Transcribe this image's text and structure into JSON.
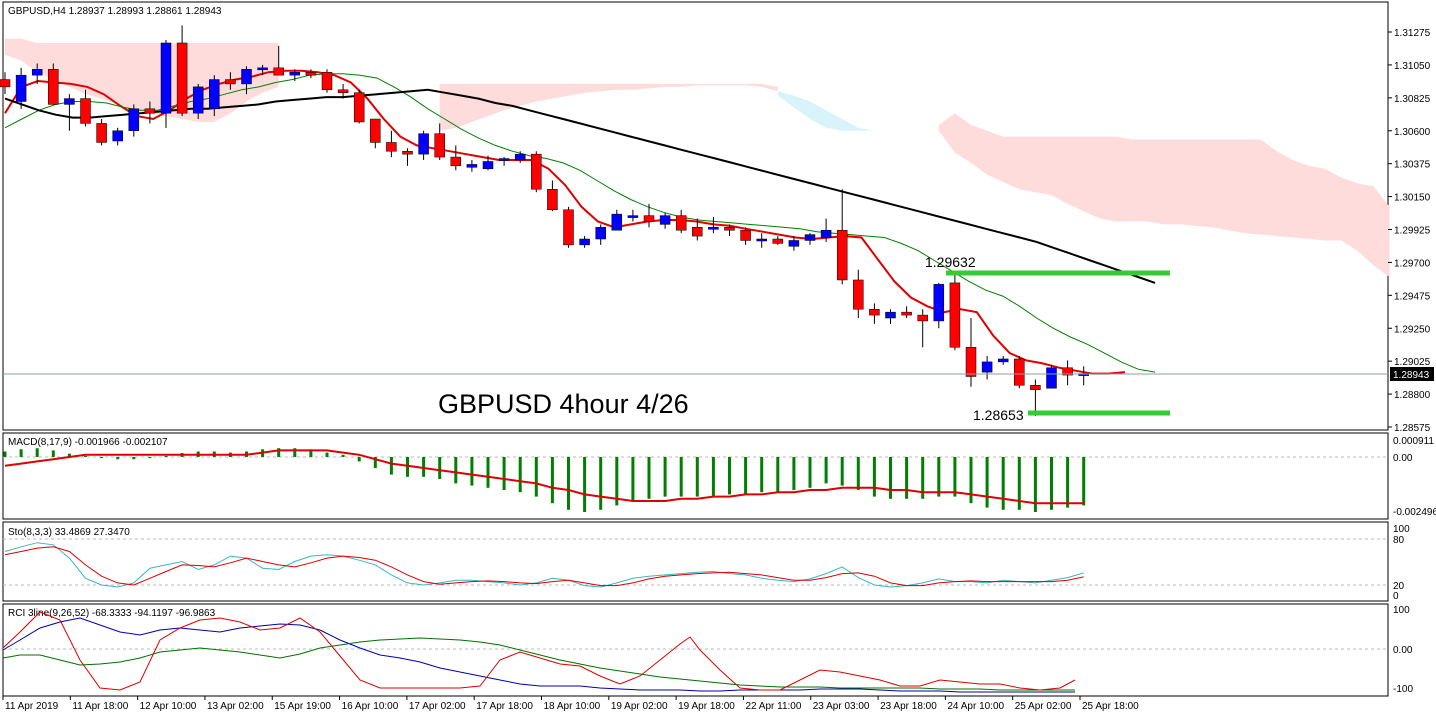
{
  "header": {
    "symbol_line": "GBPUSD,H4  1.28937 1.28993 1.28861 1.28943",
    "annotation": "GBPUSD 4hour 4/26"
  },
  "price_axis": {
    "ticks": [
      "1.31275",
      "1.31050",
      "1.30825",
      "1.30600",
      "1.30375",
      "1.30150",
      "1.29925",
      "1.29700",
      "1.29475",
      "1.29250",
      "1.29025",
      "1.28800",
      "1.28575"
    ],
    "tick_values": [
      1.31275,
      1.3105,
      1.30825,
      1.306,
      1.30375,
      1.3015,
      1.29925,
      1.297,
      1.29475,
      1.2925,
      1.29025,
      1.288,
      1.28575
    ],
    "current_price_label": "1.28943",
    "current_price": 1.28943
  },
  "time_axis": {
    "labels": [
      "11 Apr 2019",
      "11 Apr 18:00",
      "12 Apr 10:00",
      "13 Apr 02:00",
      "15 Apr 19:00",
      "16 Apr 10:00",
      "17 Apr 02:00",
      "17 Apr 18:00",
      "18 Apr 10:00",
      "19 Apr 02:00",
      "19 Apr 18:00",
      "22 Apr 11:00",
      "23 Apr 03:00",
      "23 Apr 18:00",
      "24 Apr 10:00",
      "25 Apr 02:00",
      "25 Apr 18:00"
    ]
  },
  "levels": {
    "high_label": "1.29632",
    "high_value": 1.29632,
    "low_label": "1.28653",
    "low_value": 1.28653
  },
  "macd": {
    "title": "MACD(8,17,9) -0.001966 -0.002107",
    "ticks": [
      "0.000911",
      "0.00",
      "-0.002496"
    ]
  },
  "stochastic": {
    "title": "Sto(8,3,3) 33.4869 27.3470",
    "ticks": [
      "100",
      "80",
      "20",
      "0"
    ]
  },
  "rci": {
    "title": "RCI 3line(9,26,52) -68.3333 -94.1197 -96.9863",
    "ticks": [
      "100",
      "0.00",
      "-100"
    ]
  },
  "colors": {
    "bull": "#0000ff",
    "bear": "#ff0000",
    "kumo_bear": "#ffdcdc",
    "kumo_bull": "#d8f4fa",
    "ma_fast": "#e00000",
    "ma_mid": "#008000",
    "ma_slow": "#000000",
    "level_line": "#33cc33",
    "macd_hist": "#008000",
    "macd_signal": "#dd0000",
    "sto_main": "#3cb4c8",
    "sto_signal": "#dd0000",
    "rci_short": "#dd0000",
    "rci_mid": "#007000",
    "rci_long": "#0000aa"
  },
  "chart_data": {
    "type": "candlestick",
    "title": "GBPUSD,H4",
    "ylim": [
      1.28575,
      1.31275
    ],
    "candles": [
      [
        1.3095,
        1.31,
        1.3085,
        1.309
      ],
      [
        1.308,
        1.3103,
        1.3075,
        1.3098
      ],
      [
        1.3098,
        1.3106,
        1.3092,
        1.3102
      ],
      [
        1.3102,
        1.3106,
        1.3078,
        1.3078
      ],
      [
        1.3078,
        1.3085,
        1.306,
        1.3082
      ],
      [
        1.3082,
        1.3088,
        1.3063,
        1.3065
      ],
      [
        1.3065,
        1.3068,
        1.305,
        1.3052
      ],
      [
        1.3053,
        1.3062,
        1.305,
        1.306
      ],
      [
        1.306,
        1.3078,
        1.3056,
        1.3075
      ],
      [
        1.3075,
        1.308,
        1.3065,
        1.3072
      ],
      [
        1.3072,
        1.3122,
        1.3062,
        1.312
      ],
      [
        1.312,
        1.3132,
        1.307,
        1.3072
      ],
      [
        1.3072,
        1.3092,
        1.3068,
        1.309
      ],
      [
        1.3075,
        1.3098,
        1.307,
        1.3095
      ],
      [
        1.3095,
        1.31,
        1.3088,
        1.3092
      ],
      [
        1.3092,
        1.3104,
        1.3085,
        1.3102
      ],
      [
        1.3102,
        1.3105,
        1.3098,
        1.3103
      ],
      [
        1.3103,
        1.3118,
        1.3098,
        1.3098
      ],
      [
        1.3098,
        1.3102,
        1.3094,
        1.31
      ],
      [
        1.31,
        1.3102,
        1.3096,
        1.3098
      ],
      [
        1.31,
        1.3102,
        1.3086,
        1.3088
      ],
      [
        1.3088,
        1.3092,
        1.3082,
        1.3086
      ],
      [
        1.3086,
        1.3088,
        1.3065,
        1.3066
      ],
      [
        1.3068,
        1.3068,
        1.3048,
        1.3052
      ],
      [
        1.3052,
        1.306,
        1.3042,
        1.3046
      ],
      [
        1.3046,
        1.3048,
        1.3036,
        1.3044
      ],
      [
        1.3044,
        1.306,
        1.304,
        1.3058
      ],
      [
        1.3058,
        1.3065,
        1.304,
        1.3042
      ],
      [
        1.3042,
        1.305,
        1.3033,
        1.3036
      ],
      [
        1.3035,
        1.304,
        1.3032,
        1.3037
      ],
      [
        1.3034,
        1.3043,
        1.3033,
        1.3039
      ],
      [
        1.304,
        1.3042,
        1.3036,
        1.3041
      ],
      [
        1.304,
        1.3046,
        1.3038,
        1.3044
      ],
      [
        1.3044,
        1.3046,
        1.3018,
        1.302
      ],
      [
        1.302,
        1.3026,
        1.3005,
        1.3006
      ],
      [
        1.3006,
        1.3008,
        1.298,
        1.2982
      ],
      [
        1.2982,
        1.2988,
        1.298,
        1.2986
      ],
      [
        1.2986,
        1.2996,
        1.2982,
        1.2994
      ],
      [
        1.2992,
        1.3006,
        1.2992,
        1.3003
      ],
      [
        1.3001,
        1.3006,
        1.2998,
        1.3002
      ],
      [
        1.3002,
        1.301,
        1.2994,
        1.2998
      ],
      [
        1.2996,
        1.3004,
        1.2993,
        1.3002
      ],
      [
        1.3002,
        1.3006,
        1.299,
        1.2992
      ],
      [
        1.2994,
        1.3,
        1.2985,
        1.2988
      ],
      [
        1.2993,
        1.3001,
        1.299,
        1.2994
      ],
      [
        1.2994,
        1.2996,
        1.2988,
        1.2992
      ],
      [
        1.2992,
        1.2994,
        1.2982,
        1.2985
      ],
      [
        1.2985,
        1.299,
        1.298,
        1.2986
      ],
      [
        1.2986,
        1.2988,
        1.2982,
        1.2983
      ],
      [
        1.2981,
        1.2988,
        1.2978,
        1.2985
      ],
      [
        1.2985,
        1.299,
        1.2982,
        1.2989
      ],
      [
        1.2987,
        1.3,
        1.2984,
        1.2992
      ],
      [
        1.2992,
        1.302,
        1.2955,
        1.2958
      ],
      [
        1.2958,
        1.2965,
        1.2932,
        1.2938
      ],
      [
        1.2938,
        1.2942,
        1.2928,
        1.2934
      ],
      [
        1.2932,
        1.2938,
        1.2928,
        1.2936
      ],
      [
        1.2936,
        1.294,
        1.2932,
        1.2934
      ],
      [
        1.2934,
        1.2938,
        1.2912,
        1.293
      ],
      [
        1.293,
        1.2956,
        1.2925,
        1.2955
      ],
      [
        1.2956,
        1.2963,
        1.291,
        1.2912
      ],
      [
        1.2912,
        1.2932,
        1.2885,
        1.2892
      ],
      [
        1.2895,
        1.2906,
        1.289,
        1.2902
      ],
      [
        1.2902,
        1.2906,
        1.29,
        1.2904
      ],
      [
        1.2904,
        1.2906,
        1.2884,
        1.2886
      ],
      [
        1.2886,
        1.289,
        1.2865,
        1.2883
      ],
      [
        1.2884,
        1.29,
        1.2884,
        1.2898
      ],
      [
        1.2898,
        1.2903,
        1.2886,
        1.2893
      ],
      [
        1.2894,
        1.2899,
        1.2886,
        1.2894
      ]
    ],
    "series": [
      {
        "values": [
          1.3072,
          1.309,
          1.3094,
          1.3093,
          1.3092,
          1.309,
          1.3085,
          1.3077,
          1.307,
          1.3068,
          1.3074,
          1.3082,
          1.3088,
          1.3092,
          1.3095,
          1.3097,
          1.31,
          1.3101,
          1.3101,
          1.31,
          1.3098,
          1.3093,
          1.3082,
          1.3068,
          1.3056,
          1.305,
          1.3048,
          1.3046,
          1.3044,
          1.3042,
          1.304,
          1.304,
          1.304,
          1.3034,
          1.3023,
          1.3008,
          1.2998,
          1.2994,
          1.2996,
          1.2998,
          1.2999,
          1.2999,
          1.2998,
          1.2996,
          1.2995,
          1.2993,
          1.2991,
          1.2989,
          1.2987,
          1.2986,
          1.2987,
          1.2988,
          1.2987,
          1.2972,
          1.2957,
          1.2946,
          1.294,
          1.2936,
          1.2938,
          1.2936,
          1.292,
          1.2908,
          1.2903,
          1.2901,
          1.2898,
          1.2896,
          1.2894,
          1.2894,
          1.2895
        ]
      },
      {
        "values": [
          1.3062,
          1.3068,
          1.3074,
          1.3078,
          1.308,
          1.308,
          1.3079,
          1.3076,
          1.3074,
          1.3074,
          1.3077,
          1.308,
          1.3082,
          1.3085,
          1.3088,
          1.309,
          1.3093,
          1.3095,
          1.3098,
          1.3099,
          1.3099,
          1.3098,
          1.3096,
          1.309,
          1.3083,
          1.3075,
          1.3068,
          1.3061,
          1.3055,
          1.305,
          1.3046,
          1.3043,
          1.3041,
          1.3038,
          1.3033,
          1.3026,
          1.3019,
          1.3013,
          1.3008,
          1.3004,
          1.3001,
          1.2999,
          1.2998,
          1.2997,
          1.2996,
          1.2995,
          1.2994,
          1.2993,
          1.2991,
          1.299,
          1.2989,
          1.2988,
          1.2987,
          1.2983,
          1.2978,
          1.2971,
          1.2964,
          1.2957,
          1.2951,
          1.2947,
          1.294,
          1.2932,
          1.2925,
          1.2919,
          1.2914,
          1.2908,
          1.2902,
          1.2897,
          1.2895
        ]
      },
      {
        "values": [
          1.3082,
          1.3078,
          1.3074,
          1.3071,
          1.3069,
          1.3069,
          1.307,
          1.3071,
          1.3072,
          1.3073,
          1.3074,
          1.3075,
          1.3075,
          1.3076,
          1.3077,
          1.3078,
          1.308,
          1.3081,
          1.3082,
          1.3083,
          1.3083,
          1.3084,
          1.3085,
          1.3086,
          1.3087,
          1.3088,
          1.3086,
          1.3084,
          1.3082,
          1.3079,
          1.3077,
          1.3074,
          1.3071,
          1.3068,
          1.3065,
          1.3062,
          1.3059,
          1.3056,
          1.3053,
          1.305,
          1.3047,
          1.3044,
          1.3041,
          1.3038,
          1.3035,
          1.3032,
          1.3029,
          1.3026,
          1.3023,
          1.302,
          1.3017,
          1.3014,
          1.3011,
          1.3008,
          1.3005,
          1.3002,
          1.2999,
          1.2996,
          1.2993,
          1.299,
          1.2987,
          1.2984,
          1.298,
          1.2976,
          1.2972,
          1.2968,
          1.2964,
          1.296,
          1.2956
        ]
      }
    ],
    "kumo": [
      {
        "x0": 0,
        "x1": 17,
        "top": [
          1.3123,
          1.3123,
          1.312,
          1.312,
          1.312,
          1.312,
          1.312,
          1.312,
          1.312,
          1.312,
          1.312,
          1.312,
          1.312,
          1.312,
          1.312,
          1.312,
          1.312,
          1.312
        ],
        "bottom": [
          1.3112,
          1.3108,
          1.31,
          1.3095,
          1.309,
          1.3085,
          1.3082,
          1.3078,
          1.3074,
          1.3072,
          1.307,
          1.3068,
          1.3066,
          1.3066,
          1.3072,
          1.308,
          1.3086,
          1.309
        ]
      },
      {
        "x0": 27,
        "x1": 48,
        "top": [
          1.3092,
          1.3092,
          1.3092,
          1.3092,
          1.3092,
          1.3092,
          1.3092,
          1.3092,
          1.3092,
          1.3092,
          1.3092,
          1.3092,
          1.3092,
          1.3092,
          1.3092,
          1.3092,
          1.3092,
          1.3092,
          1.3092,
          1.3092,
          1.3092,
          1.309
        ],
        "bottom": [
          1.306,
          1.3062,
          1.3066,
          1.307,
          1.3074,
          1.3077,
          1.308,
          1.3082,
          1.3084,
          1.3086,
          1.3087,
          1.3088,
          1.3088,
          1.3089,
          1.309,
          1.309,
          1.3091,
          1.3091,
          1.3091,
          1.3091,
          1.309,
          1.3087
        ]
      },
      {
        "x0": 58,
        "x1": 86,
        "top": [
          1.3064,
          1.3072,
          1.3064,
          1.306,
          1.3056,
          1.3056,
          1.3056,
          1.3056,
          1.3056,
          1.3056,
          1.3056,
          1.3056,
          1.3054,
          1.3054,
          1.3054,
          1.3054,
          1.3054,
          1.3054,
          1.3054,
          1.3054,
          1.3054,
          1.3046,
          1.304,
          1.3036,
          1.3034,
          1.3028,
          1.3024,
          1.3022,
          1.3008
        ],
        "bottom": [
          1.306,
          1.3045,
          1.3038,
          1.303,
          1.3025,
          1.302,
          1.3018,
          1.3016,
          1.301,
          1.3005,
          1.3,
          1.2998,
          1.2998,
          1.2998,
          1.2996,
          1.2996,
          1.2995,
          1.2994,
          1.2992,
          1.299,
          1.2989,
          1.2988,
          1.2987,
          1.2986,
          1.2985,
          1.2985,
          1.2978,
          1.2968,
          1.296
        ]
      }
    ],
    "kumo_twist": {
      "x0": 48,
      "x1": 58,
      "top": [
        1.3087,
        1.3084,
        1.308,
        1.3074,
        1.3068,
        1.3062,
        1.306,
        1.306,
        1.306,
        1.306,
        1.306
      ],
      "bottom": [
        1.3084,
        1.3076,
        1.3068,
        1.3062,
        1.306,
        1.306,
        1.306,
        1.306,
        1.306,
        1.306,
        1.306
      ]
    },
    "macd_hist": [
      0.00025,
      0.00035,
      0.0004,
      0.0003,
      0.00015,
      5e-05,
      -5e-05,
      -0.0001,
      -0.0001,
      -5e-05,
      5e-05,
      0.00018,
      0.00025,
      0.00025,
      0.0002,
      0.00025,
      0.00035,
      0.0004,
      0.0004,
      0.00035,
      0.0002,
      0.0001,
      -0.0002,
      -0.0005,
      -0.0008,
      -0.0009,
      -0.0009,
      -0.001,
      -0.0012,
      -0.0013,
      -0.0014,
      -0.0015,
      -0.0016,
      -0.0018,
      -0.0021,
      -0.0024,
      -0.0025,
      -0.0024,
      -0.0022,
      -0.002,
      -0.0019,
      -0.0018,
      -0.0018,
      -0.0018,
      -0.0018,
      -0.0017,
      -0.0017,
      -0.0016,
      -0.0016,
      -0.0015,
      -0.0014,
      -0.0012,
      -0.0013,
      -0.0015,
      -0.0018,
      -0.0019,
      -0.0019,
      -0.0019,
      -0.0018,
      -0.0018,
      -0.0021,
      -0.0023,
      -0.0024,
      -0.0024,
      -0.0025,
      -0.0024,
      -0.0023,
      -0.0022
    ],
    "macd_signal": [
      -0.0004,
      -0.0003,
      -0.0002,
      -0.0001,
      0.0,
      0.0001,
      0.0001,
      0.0001,
      0.0001,
      0.0001,
      0.0001,
      0.0001,
      0.0001,
      0.0001,
      0.0001,
      0.0001,
      0.0002,
      0.0003,
      0.0003,
      0.0003,
      0.0003,
      0.0002,
      0.0001,
      -0.0001,
      -0.0003,
      -0.0004,
      -0.0005,
      -0.0006,
      -0.0007,
      -0.0008,
      -0.0009,
      -0.001,
      -0.0011,
      -0.0012,
      -0.0014,
      -0.0015,
      -0.0017,
      -0.0018,
      -0.0019,
      -0.002,
      -0.002,
      -0.002,
      -0.0019,
      -0.0019,
      -0.0018,
      -0.0018,
      -0.0017,
      -0.0017,
      -0.0016,
      -0.0016,
      -0.0015,
      -0.0015,
      -0.0014,
      -0.0014,
      -0.0014,
      -0.0015,
      -0.0015,
      -0.0016,
      -0.0016,
      -0.0016,
      -0.0017,
      -0.0018,
      -0.0019,
      -0.002,
      -0.0021,
      -0.0021,
      -0.0021,
      -0.0021
    ],
    "sto_main": [
      65,
      72,
      78,
      75,
      55,
      25,
      15,
      12,
      18,
      40,
      45,
      50,
      38,
      45,
      58,
      55,
      40,
      38,
      50,
      58,
      60,
      58,
      52,
      45,
      30,
      18,
      15,
      18,
      22,
      22,
      20,
      18,
      15,
      18,
      25,
      22,
      14,
      12,
      18,
      25,
      28,
      30,
      32,
      34,
      35,
      32,
      30,
      25,
      22,
      20,
      24,
      32,
      42,
      26,
      15,
      12,
      14,
      18,
      24,
      20,
      20,
      18,
      22,
      20,
      18,
      22,
      26,
      33
    ],
    "sto_signal": [
      60,
      65,
      70,
      72,
      65,
      45,
      28,
      18,
      15,
      25,
      35,
      45,
      44,
      42,
      48,
      55,
      50,
      45,
      42,
      48,
      55,
      58,
      56,
      52,
      42,
      30,
      20,
      16,
      18,
      20,
      21,
      20,
      18,
      17,
      20,
      22,
      18,
      14,
      14,
      18,
      24,
      28,
      30,
      32,
      33,
      34,
      32,
      30,
      26,
      22,
      22,
      26,
      32,
      33,
      28,
      18,
      14,
      14,
      18,
      20,
      21,
      20,
      20,
      20,
      20,
      20,
      22,
      27
    ]
  }
}
